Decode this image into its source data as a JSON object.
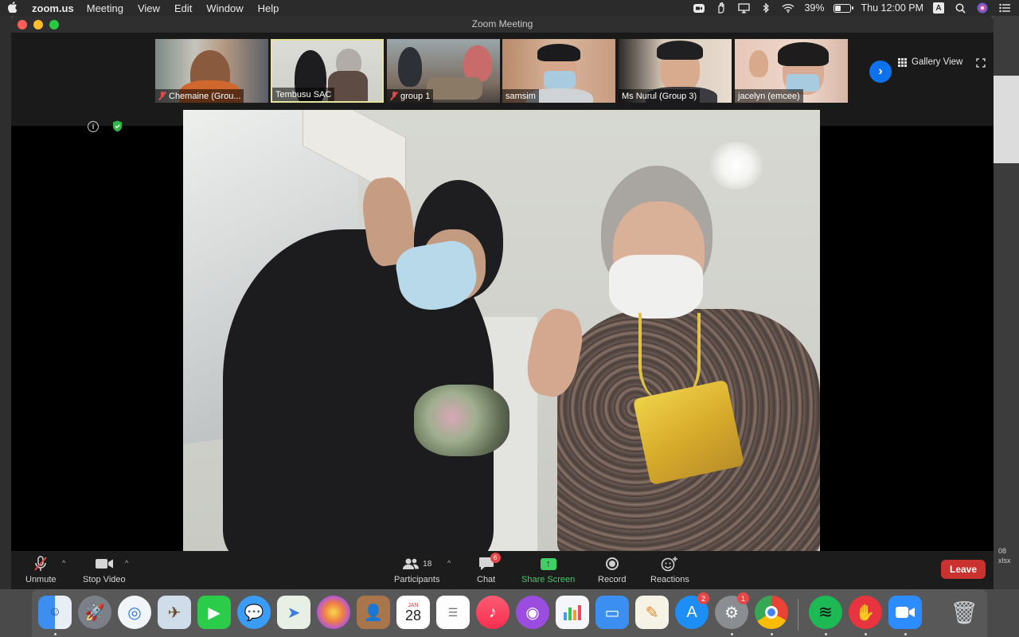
{
  "menubar": {
    "app_name": "zoom.us",
    "menus": [
      "Meeting",
      "View",
      "Edit",
      "Window",
      "Help"
    ],
    "battery_percent": "39%",
    "battery_level": 0.39,
    "clock": "Thu 12:00 PM",
    "input_source": "A"
  },
  "window": {
    "title": "Zoom Meeting"
  },
  "gallery": {
    "participants": [
      {
        "name": "Chemaine (Grou...",
        "muted": true,
        "active": false
      },
      {
        "name": "Tembusu SAC",
        "muted": false,
        "active": true
      },
      {
        "name": "group 1",
        "muted": true,
        "active": false
      },
      {
        "name": "samsim",
        "muted": false,
        "active": false
      },
      {
        "name": "Ms Nurul (Group 3)",
        "muted": false,
        "active": false
      },
      {
        "name": "jacelyn (emcee)",
        "muted": false,
        "active": false
      }
    ],
    "view_label": "Gallery View"
  },
  "controls": {
    "unmute": "Unmute",
    "stop_video": "Stop Video",
    "participants_label": "Participants",
    "participants_count": "18",
    "chat_label": "Chat",
    "chat_badge": "6",
    "share_screen": "Share Screen",
    "record": "Record",
    "reactions": "Reactions",
    "leave": "Leave"
  },
  "dock": {
    "calendar_month": "JAN",
    "calendar_day": "28",
    "app_store_badge": "2",
    "system_prefs_badge": "1"
  },
  "background": {
    "right_text_1": "08",
    "right_text_2": "xlsx"
  },
  "colors": {
    "zoom_blue": "#0e72ed",
    "share_green": "#3fcf65",
    "leave_red": "#c9322e",
    "active_speaker_border": "#e8e39a"
  }
}
